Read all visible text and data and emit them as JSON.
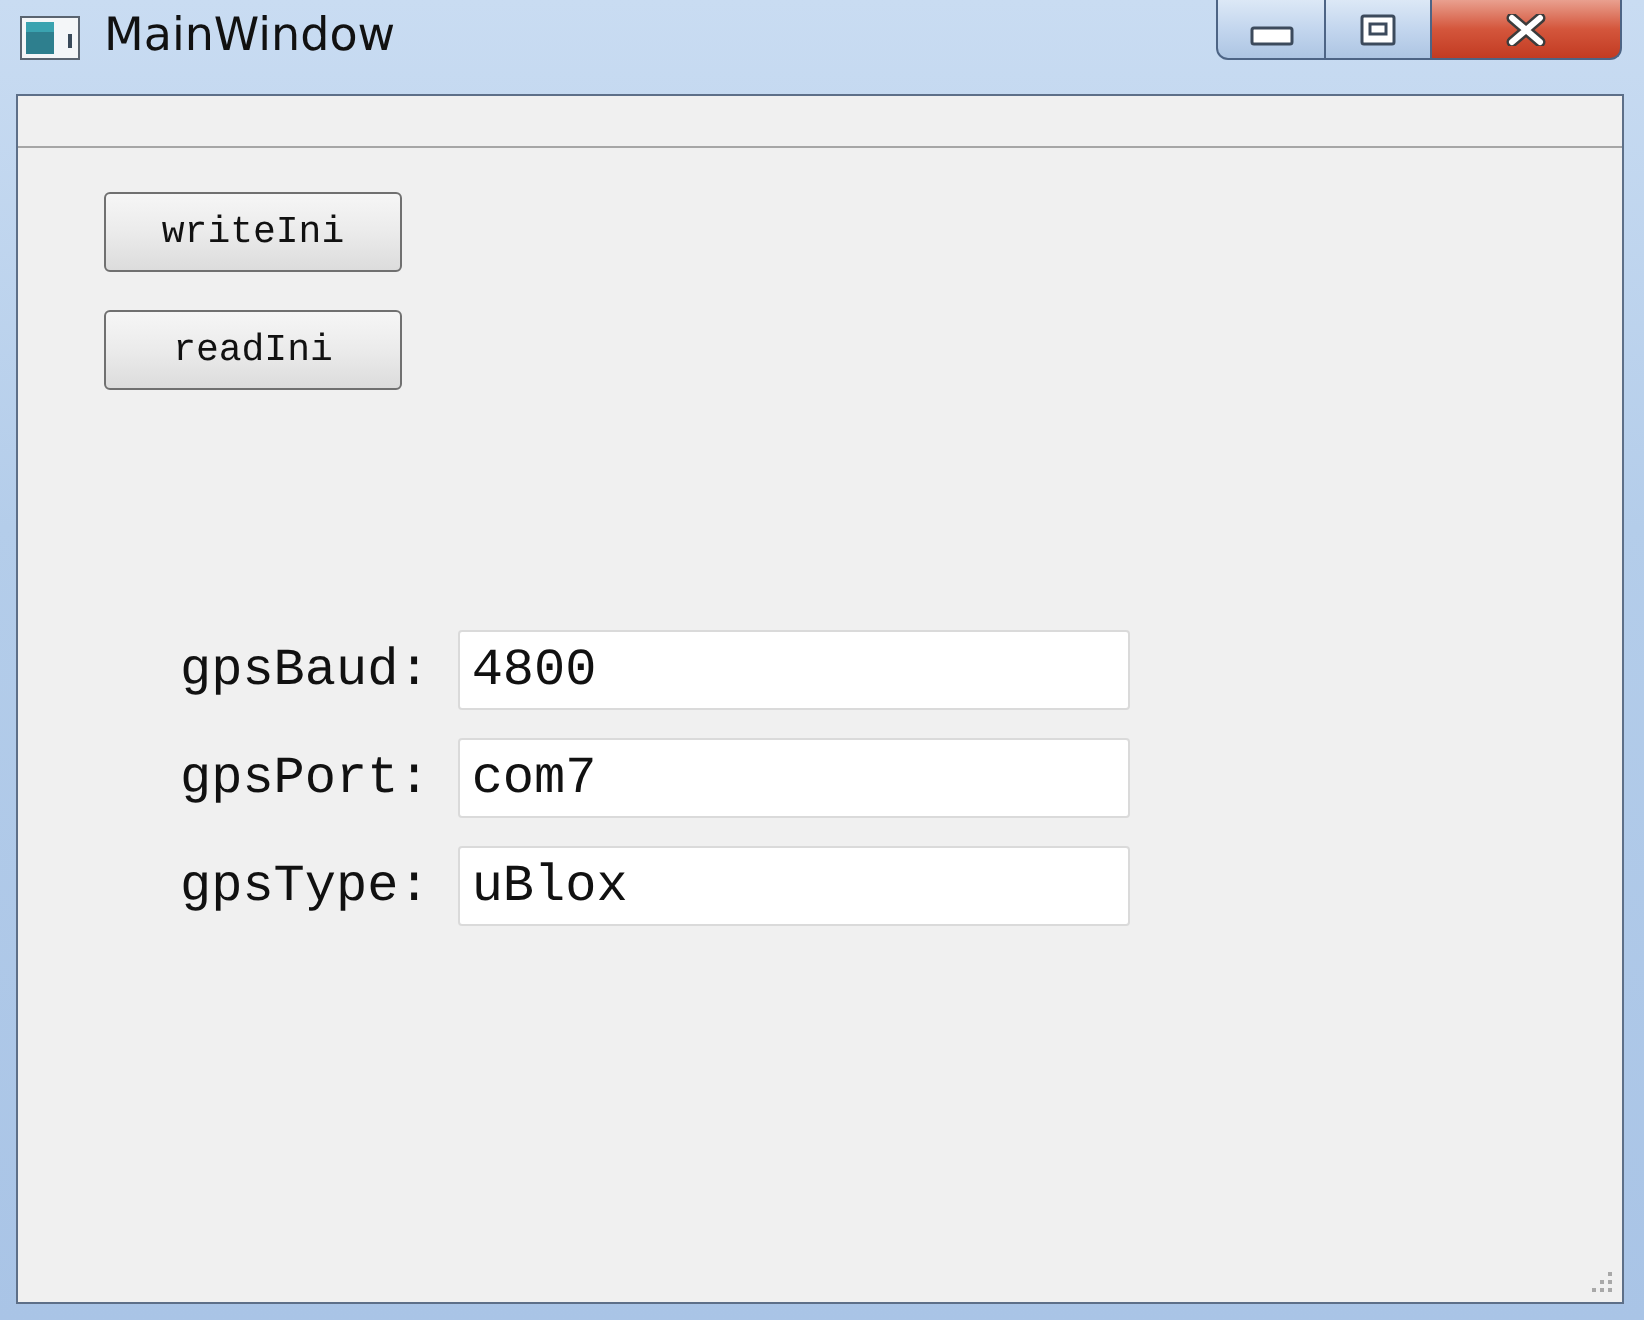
{
  "window": {
    "title": "MainWindow"
  },
  "buttons": [
    {
      "label": "writeIni"
    },
    {
      "label": "readIni"
    }
  ],
  "fields": [
    {
      "label": "gpsBaud:",
      "value": "4800"
    },
    {
      "label": "gpsPort:",
      "value": "com7"
    },
    {
      "label": "gpsType:",
      "value": "uBlox"
    }
  ]
}
